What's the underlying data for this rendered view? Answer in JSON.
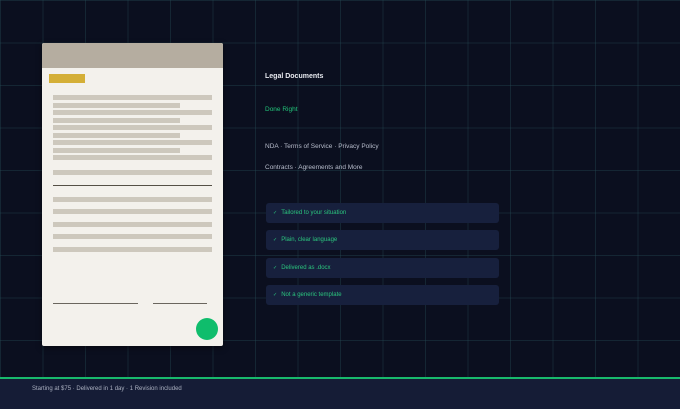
{
  "hero": {
    "title": "Legal Documents",
    "subtitle": "Done Right",
    "services_line1": "NDA · Terms of Service · Privacy Policy",
    "services_line2": "Contracts · Agreements and More"
  },
  "features": [
    {
      "icon": "check-icon",
      "label": "Tailored to your situation"
    },
    {
      "icon": "check-icon",
      "label": "Plain, clear language"
    },
    {
      "icon": "check-icon",
      "label": "Delivered as .docx"
    },
    {
      "icon": "check-icon",
      "label": "Not a generic template"
    }
  ],
  "footer": {
    "text": "Starting at $75 · Delivered in 1 day · 1 Revision included"
  },
  "colors": {
    "background": "#0b0f1f",
    "accent_green": "#22c47a",
    "gold": "#d4af37",
    "paper": "#f3f1ec",
    "card": "#17203d"
  }
}
